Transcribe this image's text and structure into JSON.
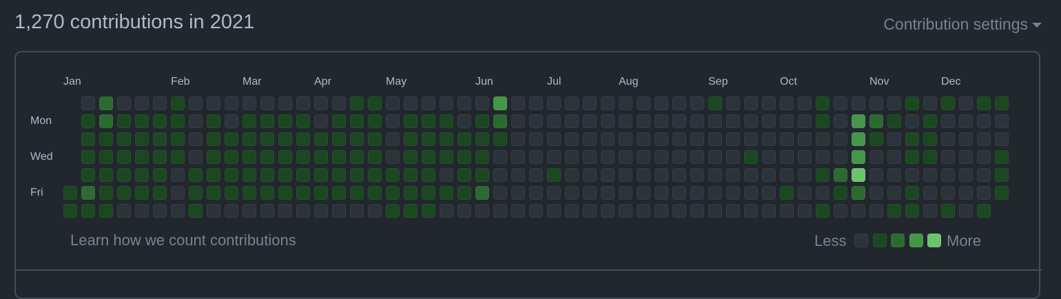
{
  "header": {
    "title": "1,270 contributions in 2021",
    "settings_label": "Contribution settings"
  },
  "months": [
    {
      "label": "Jan",
      "week": 0
    },
    {
      "label": "Feb",
      "week": 6
    },
    {
      "label": "Mar",
      "week": 10
    },
    {
      "label": "Apr",
      "week": 14
    },
    {
      "label": "May",
      "week": 18
    },
    {
      "label": "Jun",
      "week": 23
    },
    {
      "label": "Jul",
      "week": 27
    },
    {
      "label": "Aug",
      "week": 31
    },
    {
      "label": "Sep",
      "week": 36
    },
    {
      "label": "Oct",
      "week": 40
    },
    {
      "label": "Nov",
      "week": 45
    },
    {
      "label": "Dec",
      "week": 49
    }
  ],
  "days": [
    {
      "label": "Mon",
      "row": 1
    },
    {
      "label": "Wed",
      "row": 3
    },
    {
      "label": "Fri",
      "row": 5
    }
  ],
  "colors": [
    "#2d333b",
    "#1b4721",
    "#2b6a30",
    "#46954a",
    "#6bc46d"
  ],
  "chart_data": {
    "type": "heatmap",
    "description_levels": "each week string lists Sun..Sat contribution level 0-4, '-' = no day",
    "weeks": [
      "-----11",
      "0111121",
      "2211111",
      "0111110",
      "0111110",
      "0111110",
      "1111000",
      "0000111",
      "0111110",
      "0011110",
      "0111110",
      "0111110",
      "0111110",
      "0111110",
      "0011110",
      "0111110",
      "1111110",
      "1111110",
      "0000111",
      "0111111",
      "0111111",
      "0111010",
      "0011110",
      "0111120",
      "3210000",
      "0000000",
      "0000000",
      "0000100",
      "0000000",
      "0000000",
      "0000000",
      "0000000",
      "0000000",
      "0000000",
      "0000000",
      "0000000",
      "1000000",
      "0000000",
      "0001000",
      "0000000",
      "0000010",
      "0000000",
      "1100101",
      "0000210",
      "0333420",
      "0210000",
      "0100001",
      "1011011",
      "0111000",
      "1000001",
      "0000000",
      "1000001",
      "100111-"
    ]
  },
  "footer": {
    "learn_link": "Learn how we count contributions",
    "less": "Less",
    "more": "More"
  }
}
